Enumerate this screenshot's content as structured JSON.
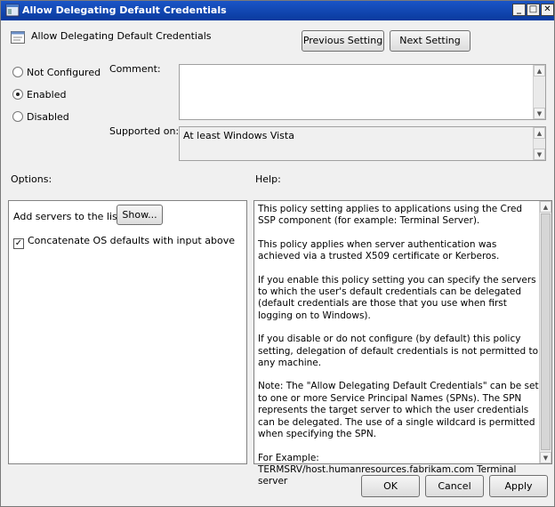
{
  "window": {
    "title": "Allow Delegating Default Credentials",
    "controls": {
      "minimize": "_",
      "maximize": "□",
      "close": "✕"
    }
  },
  "header": {
    "policy_name": "Allow Delegating Default Credentials",
    "previous_button": "Previous Setting",
    "next_button": "Next Setting"
  },
  "state": {
    "options": [
      {
        "label": "Not Configured",
        "selected": false
      },
      {
        "label": "Enabled",
        "selected": true
      },
      {
        "label": "Disabled",
        "selected": false
      }
    ]
  },
  "comment": {
    "label": "Comment:",
    "value": ""
  },
  "supported": {
    "label": "Supported on:",
    "value": "At least Windows Vista"
  },
  "options_section": {
    "title": "Options:",
    "add_servers_label": "Add servers to the list:",
    "show_button": "Show...",
    "concatenate_label": "Concatenate OS defaults with input above",
    "concatenate_checked": true
  },
  "help_section": {
    "title": "Help:",
    "paragraphs": [
      "This policy setting applies to applications using the Cred SSP component (for example: Terminal Server).",
      "This policy applies when server authentication was achieved via a trusted X509 certificate or Kerberos.",
      "If you enable this policy setting you can specify the servers to which the user's default credentials can be delegated (default credentials are those that you use when first logging on to Windows).",
      "If you disable or do not configure (by default) this policy setting, delegation of default credentials is not permitted to any machine.",
      "Note: The \"Allow Delegating Default Credentials\" can be set to one or more Service Principal Names (SPNs).  The SPN represents the target server to which the user credentials can be delegated. The use of a single wildcard is permitted when specifying the SPN.",
      "For Example:\nTERMSRV/host.humanresources.fabrikam.com Terminal server"
    ]
  },
  "footer": {
    "ok": "OK",
    "cancel": "Cancel",
    "apply": "Apply"
  },
  "colors": {
    "titlebar": "#0a3a9e",
    "window_bg": "#f0f0f0"
  }
}
